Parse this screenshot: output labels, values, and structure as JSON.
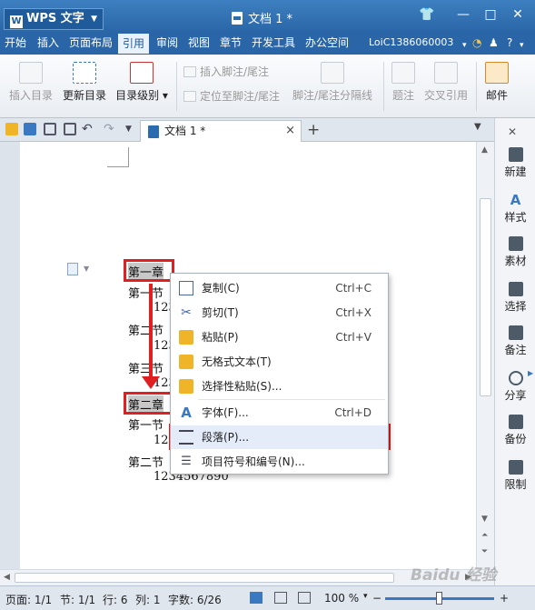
{
  "app": {
    "name": "WPS 文字",
    "logo_letter": "W",
    "doc_title": "文档 1 *"
  },
  "menu": {
    "items": [
      "开始",
      "插入",
      "页面布局",
      "引用",
      "审阅",
      "视图",
      "章节",
      "开发工具",
      "办公空间"
    ],
    "selected": "引用",
    "user": "LoiC1386060003",
    "help": "?"
  },
  "ribbon": {
    "insert_toc": "插入目录",
    "update_toc": "更新目录",
    "toc_level": "目录级别",
    "insert_footnote": "插入脚注/尾注",
    "goto_footnote": "定位至脚注/尾注",
    "footnote_separator": "脚注/尾注分隔线",
    "caption": "题注",
    "cross_ref": "交叉引用",
    "mail": "邮件"
  },
  "tab": {
    "label": "文档 1 *",
    "close": "×",
    "add": "+"
  },
  "document": {
    "lines": [
      {
        "text": "第一章"
      },
      {
        "text": "第一节"
      },
      {
        "text": "123"
      },
      {
        "text": "第二节"
      },
      {
        "text": "123"
      },
      {
        "text": "第三节"
      },
      {
        "text": "123"
      },
      {
        "text": "第二章"
      },
      {
        "text": "第一节"
      },
      {
        "text": "12"
      },
      {
        "text": "第二节"
      },
      {
        "text": "1234567890"
      }
    ]
  },
  "context_menu": {
    "items": [
      {
        "label": "复制(C)",
        "shortcut": "Ctrl+C",
        "icon": "copy-icon"
      },
      {
        "label": "剪切(T)",
        "shortcut": "Ctrl+X",
        "icon": "scissors-icon"
      },
      {
        "label": "粘贴(P)",
        "shortcut": "Ctrl+V",
        "icon": "paste-icon"
      },
      {
        "label": "无格式文本(T)",
        "shortcut": "",
        "icon": "paste-plain-icon"
      },
      {
        "label": "选择性粘贴(S)...",
        "shortcut": "",
        "icon": "paste-special-icon"
      },
      {
        "label": "字体(F)...",
        "shortcut": "Ctrl+D",
        "icon": "font-icon"
      },
      {
        "label": "段落(P)...",
        "shortcut": "",
        "icon": "paragraph-icon"
      },
      {
        "label": "项目符号和编号(N)...",
        "shortcut": "",
        "icon": "bullet-list-icon"
      }
    ],
    "highlighted": "段落(P)..."
  },
  "right_panel": [
    "新建",
    "样式",
    "素材",
    "选择",
    "备注",
    "分享",
    "备份",
    "限制"
  ],
  "status": {
    "page": "页面: 1/1",
    "section": "节: 1/1",
    "row": "行: 6",
    "col": "列: 1",
    "words": "字数: 6/26",
    "zoom": "100 %",
    "zoom_out": "−",
    "zoom_in": "+"
  },
  "watermark": "Baidu 经验",
  "colors": {
    "accent": "#2a66a7",
    "highlight_box": "#e02020",
    "menu_hover": "#e3ecf8"
  }
}
